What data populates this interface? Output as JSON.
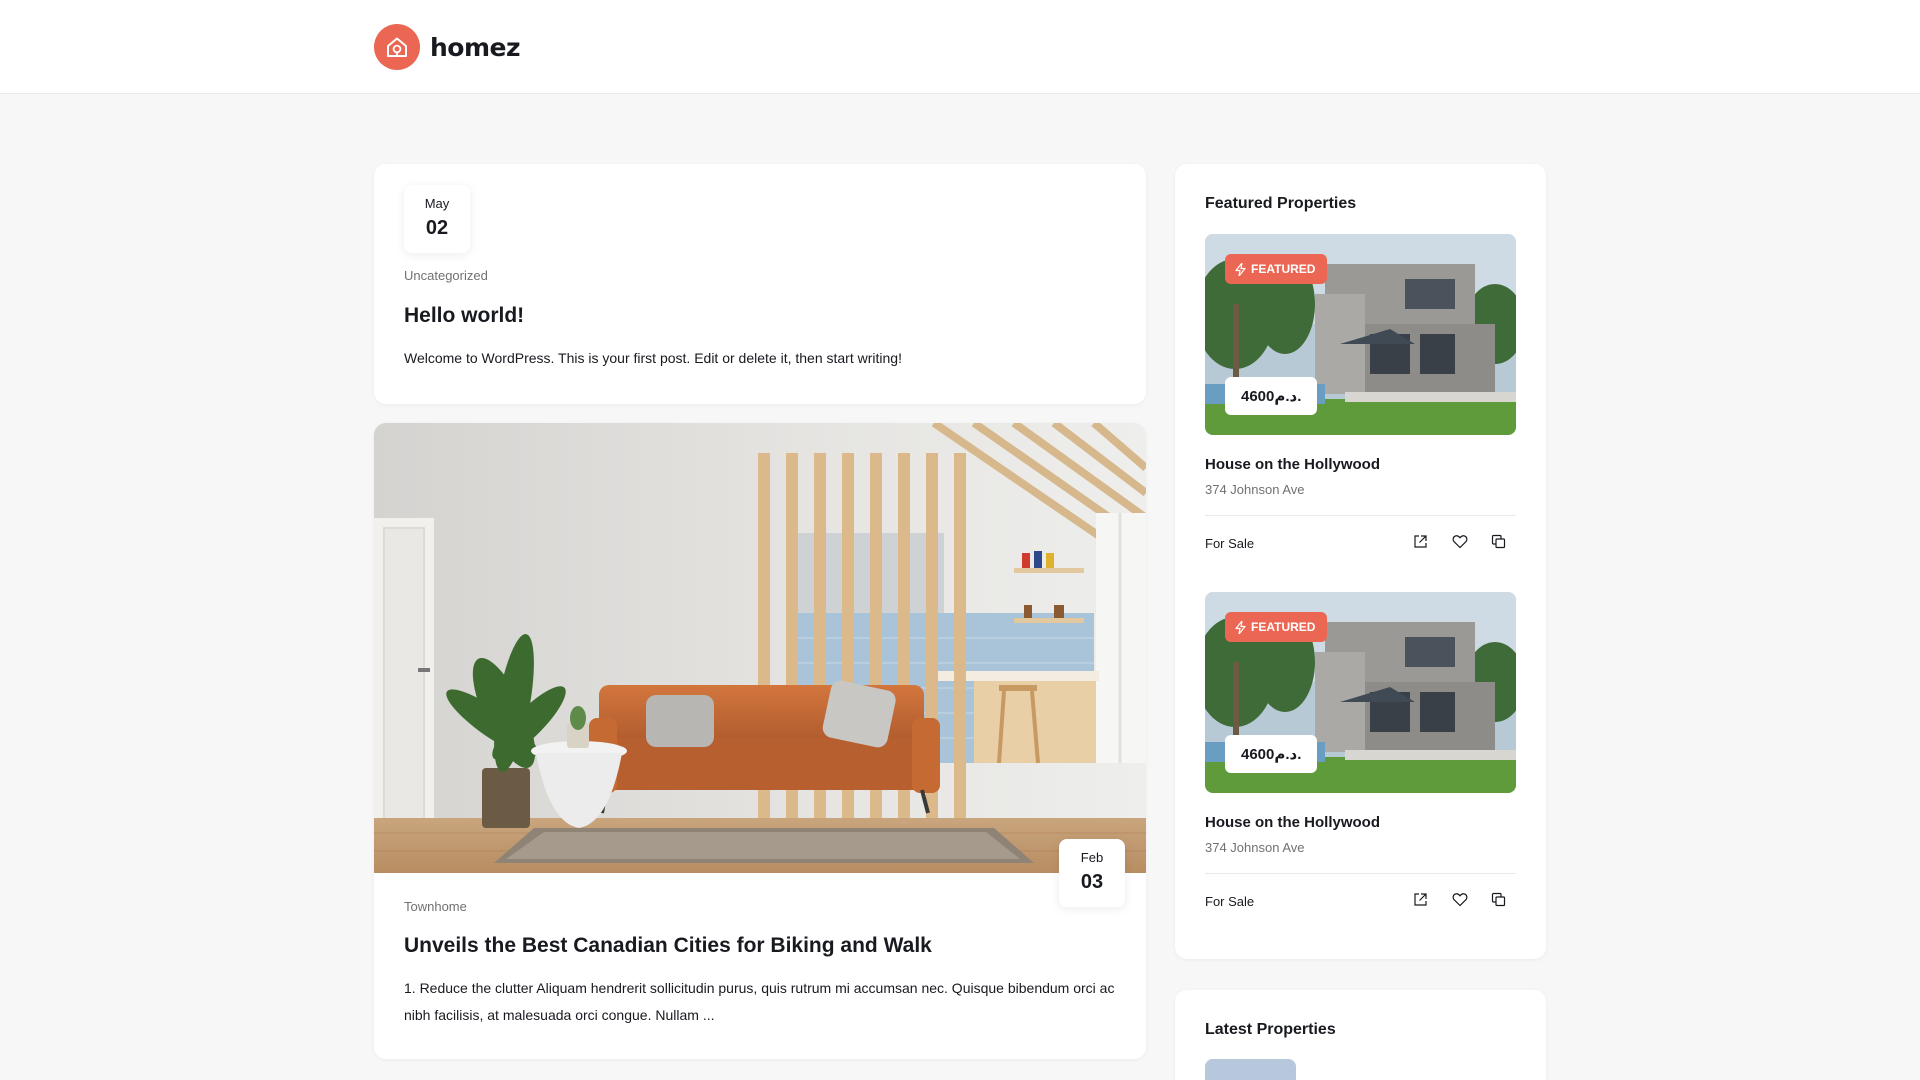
{
  "brand": {
    "name": "homez",
    "accent": "#eb6753"
  },
  "posts": [
    {
      "month": "May",
      "day": "02",
      "category": "Uncategorized",
      "title": "Hello world!",
      "excerpt": "Welcome to WordPress. This is your first post. Edit or delete it, then start writing!"
    },
    {
      "month": "Feb",
      "day": "03",
      "category": "Townhome",
      "title": "Unveils the Best Canadian Cities for Biking and Walk",
      "excerpt": "1. Reduce the clutter Aliquam hendrerit sollicitudin purus, quis rutrum mi accumsan nec. Quisque bibendum orci ac nibh facilisis, at malesuada orci congue. Nullam ..."
    }
  ],
  "sidebar": {
    "featured_title": "Featured Properties",
    "latest_title": "Latest Properties",
    "properties": [
      {
        "badge": "FEATURED",
        "price": "4600د.م.",
        "title": "House on the Hollywood",
        "address": "374 Johnson Ave",
        "status": "For Sale",
        "icons": [
          "external-link-icon",
          "heart-icon",
          "compare-icon"
        ]
      },
      {
        "badge": "FEATURED",
        "price": "4600د.م.",
        "title": "House on the Hollywood",
        "address": "374 Johnson Ave",
        "status": "For Sale",
        "icons": [
          "external-link-icon",
          "heart-icon",
          "compare-icon"
        ]
      }
    ]
  }
}
